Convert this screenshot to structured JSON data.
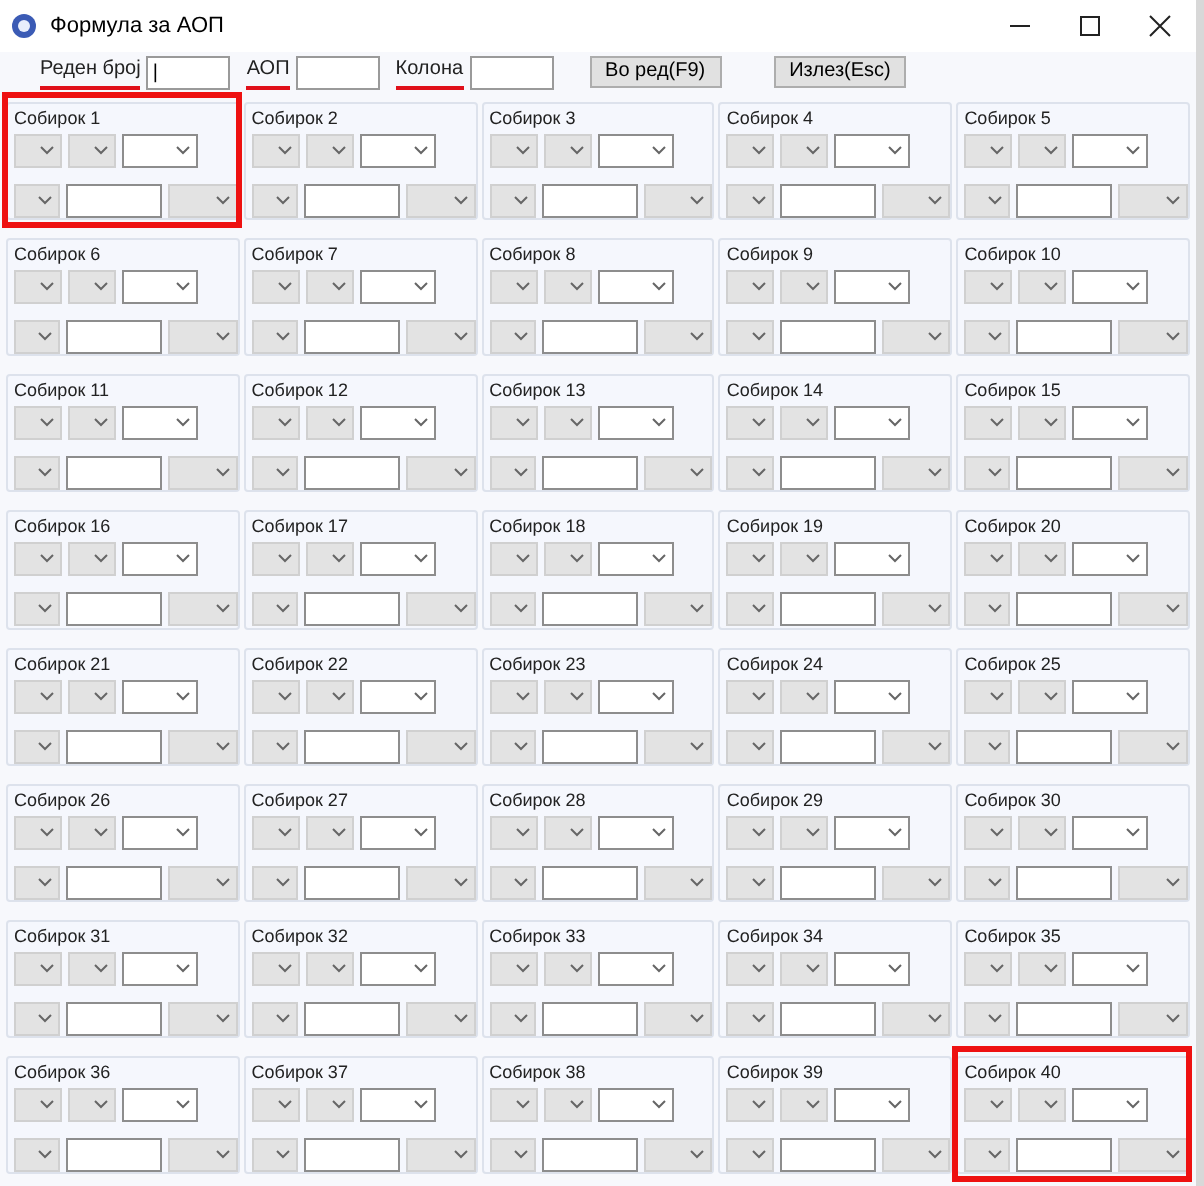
{
  "window": {
    "title": "Формула за АОП"
  },
  "toolbar": {
    "fields": [
      {
        "label": "Реден број",
        "value": "|",
        "underlined": true
      },
      {
        "label": "АОП",
        "underlined": true
      },
      {
        "label": "Колона",
        "underlined": true
      }
    ],
    "buttons": [
      "Во ред(F9)",
      "Излез(Esc)"
    ]
  },
  "group_fields": [
    {
      "kind": "combo",
      "disabled": true
    },
    {
      "kind": "combo",
      "disabled": true
    },
    {
      "kind": "combo",
      "disabled": false
    },
    {
      "kind": "combo",
      "disabled": true
    },
    {
      "kind": "input",
      "disabled": false
    },
    {
      "kind": "combo",
      "disabled": true
    }
  ],
  "groups": [
    {
      "label": "Собирок 1",
      "highlighted": true
    },
    {
      "label": "Собирок 2",
      "highlighted": false
    },
    {
      "label": "Собирок 3",
      "highlighted": false
    },
    {
      "label": "Собирок 4",
      "highlighted": false
    },
    {
      "label": "Собирок 5",
      "highlighted": false
    },
    {
      "label": "Собирок 6",
      "highlighted": false
    },
    {
      "label": "Собирок 7",
      "highlighted": false
    },
    {
      "label": "Собирок 8",
      "highlighted": false
    },
    {
      "label": "Собирок 9",
      "highlighted": false
    },
    {
      "label": "Собирок 10",
      "highlighted": false
    },
    {
      "label": "Собирок 11",
      "highlighted": false
    },
    {
      "label": "Собирок 12",
      "highlighted": false
    },
    {
      "label": "Собирок 13",
      "highlighted": false
    },
    {
      "label": "Собирок 14",
      "highlighted": false
    },
    {
      "label": "Собирок 15",
      "highlighted": false
    },
    {
      "label": "Собирок 16",
      "highlighted": false
    },
    {
      "label": "Собирок 17",
      "highlighted": false
    },
    {
      "label": "Собирок 18",
      "highlighted": false
    },
    {
      "label": "Собирок 19",
      "highlighted": false
    },
    {
      "label": "Собирок 20",
      "highlighted": false
    },
    {
      "label": "Собирок 21",
      "highlighted": false
    },
    {
      "label": "Собирок 22",
      "highlighted": false
    },
    {
      "label": "Собирок 23",
      "highlighted": false
    },
    {
      "label": "Собирок 24",
      "highlighted": false
    },
    {
      "label": "Собирок 25",
      "highlighted": false
    },
    {
      "label": "Собирок 26",
      "highlighted": false
    },
    {
      "label": "Собирок 27",
      "highlighted": false
    },
    {
      "label": "Собирок 28",
      "highlighted": false
    },
    {
      "label": "Собирок 29",
      "highlighted": false
    },
    {
      "label": "Собирок 30",
      "highlighted": false
    },
    {
      "label": "Собирок 31",
      "highlighted": false
    },
    {
      "label": "Собирок 32",
      "highlighted": false
    },
    {
      "label": "Собирок 33",
      "highlighted": false
    },
    {
      "label": "Собирок 34",
      "highlighted": false
    },
    {
      "label": "Собирок 35",
      "highlighted": false
    },
    {
      "label": "Собирок 36",
      "highlighted": false
    },
    {
      "label": "Собирок 37",
      "highlighted": false
    },
    {
      "label": "Собирок 38",
      "highlighted": false
    },
    {
      "label": "Собирок 39",
      "highlighted": false
    },
    {
      "label": "Собирок 40",
      "highlighted": true
    }
  ]
}
